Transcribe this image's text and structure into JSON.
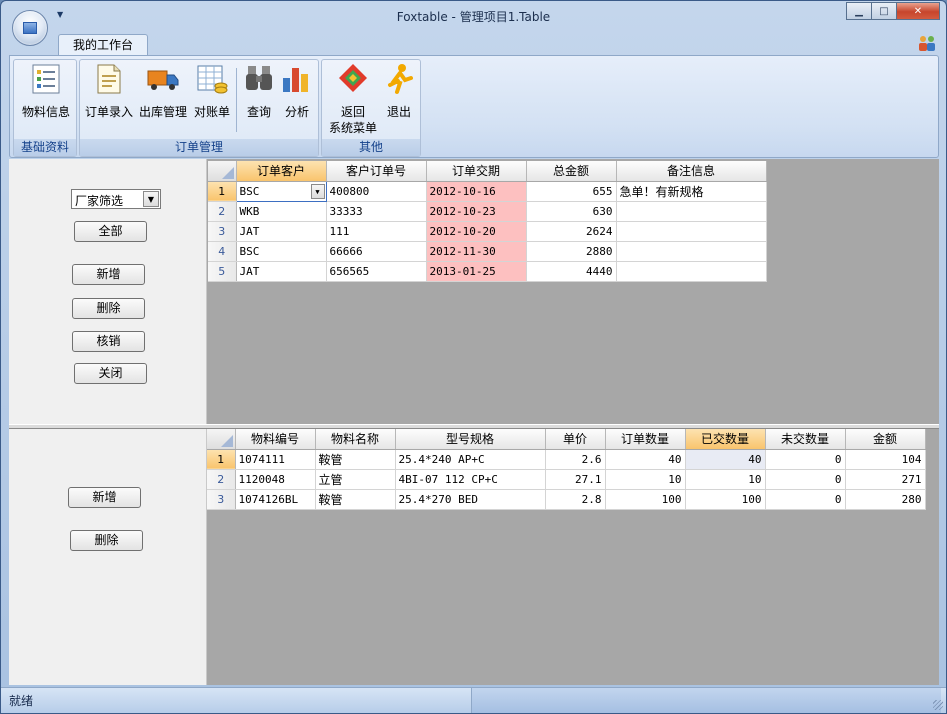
{
  "window": {
    "title": "Foxtable - 管理项目1.Table",
    "minimize": "▁",
    "maximize": "□",
    "close": "✕"
  },
  "ribbon": {
    "tab": "我的工作台",
    "groups": [
      {
        "label": "基础资料",
        "buttons": [
          {
            "label": "物料信息",
            "icon": "list-form-icon"
          }
        ]
      },
      {
        "label": "订单管理",
        "buttons": [
          {
            "label": "订单录入",
            "icon": "document-icon"
          },
          {
            "label": "出库管理",
            "icon": "truck-icon"
          },
          {
            "label": "对账单",
            "icon": "spreadsheet-coins-icon"
          },
          {
            "label": "查询",
            "icon": "binoculars-icon"
          },
          {
            "label": "分析",
            "icon": "bar-chart-icon"
          }
        ]
      },
      {
        "label": "其他",
        "buttons": [
          {
            "label": "返回\n系统菜单",
            "line1": "返回",
            "line2": "系统菜单",
            "icon": "back-arrows-icon"
          },
          {
            "label": "退出",
            "icon": "running-man-icon"
          }
        ]
      }
    ]
  },
  "top_panel": {
    "filter": {
      "value": "厂家筛选"
    },
    "buttons": {
      "all": "全部",
      "add": "新增",
      "delete": "删除",
      "verify": "核销",
      "close": "关闭"
    }
  },
  "orders": {
    "columns": [
      "订单客户",
      "客户订单号",
      "订单交期",
      "总金额",
      "备注信息"
    ],
    "rows": [
      {
        "no": "1",
        "customer": "BSC",
        "order_no": "400800",
        "due": "2012-10-16",
        "amount": "655",
        "note": "急单！有新规格"
      },
      {
        "no": "2",
        "customer": "WKB",
        "order_no": "33333",
        "due": "2012-10-23",
        "amount": "630",
        "note": ""
      },
      {
        "no": "3",
        "customer": "JAT",
        "order_no": "111",
        "due": "2012-10-20",
        "amount": "2624",
        "note": ""
      },
      {
        "no": "4",
        "customer": "BSC",
        "order_no": "66666",
        "due": "2012-11-30",
        "amount": "2880",
        "note": ""
      },
      {
        "no": "5",
        "customer": "JAT",
        "order_no": "656565",
        "due": "2013-01-25",
        "amount": "4440",
        "note": ""
      }
    ]
  },
  "bottom_panel": {
    "buttons": {
      "add": "新增",
      "delete": "删除"
    }
  },
  "details": {
    "columns": [
      "物料编号",
      "物料名称",
      "型号规格",
      "单价",
      "订单数量",
      "已交数量",
      "未交数量",
      "金额"
    ],
    "rows": [
      {
        "no": "1",
        "code": "1074111",
        "name": "鞍管",
        "spec": "25.4*240 AP+C",
        "price": "2.6",
        "qty": "40",
        "delivered": "40",
        "pending": "0",
        "amount": "104"
      },
      {
        "no": "2",
        "code": "1120048",
        "name": "立管",
        "spec": "4BI-07 112 CP+C",
        "price": "27.1",
        "qty": "10",
        "delivered": "10",
        "pending": "0",
        "amount": "271"
      },
      {
        "no": "3",
        "code": "1074126BL",
        "name": "鞍管",
        "spec": "25.4*270 BED",
        "price": "2.8",
        "qty": "100",
        "delivered": "100",
        "pending": "0",
        "amount": "280"
      }
    ]
  },
  "status": {
    "text": "就绪"
  }
}
